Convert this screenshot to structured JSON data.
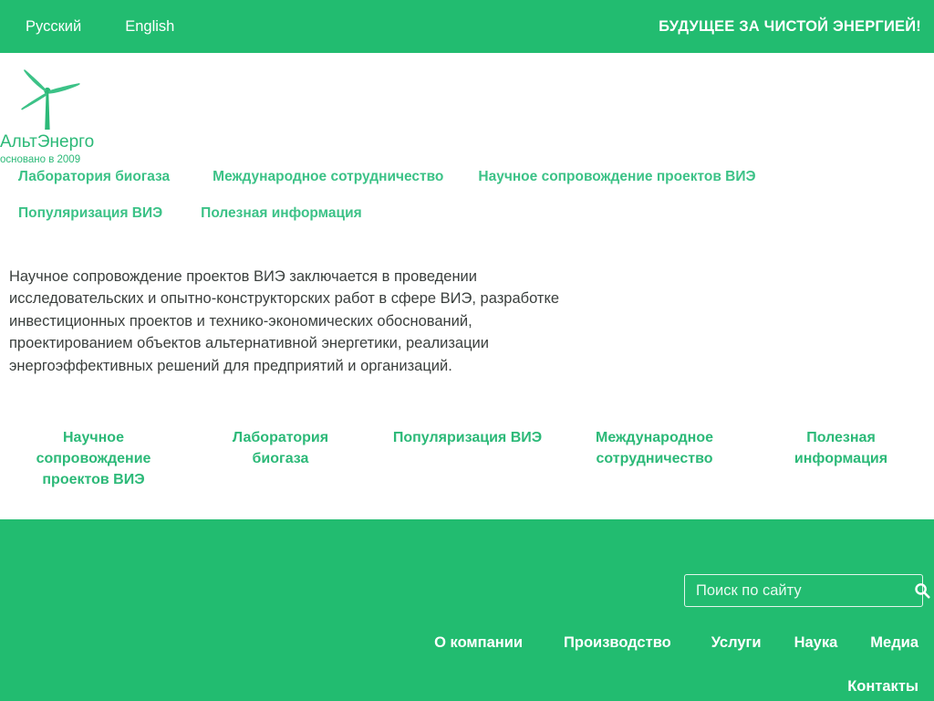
{
  "topbar": {
    "languages": [
      {
        "label": "Русский",
        "name": "lang-ru"
      },
      {
        "label": "English",
        "name": "lang-en"
      }
    ],
    "slogan": "БУДУЩЕЕ ЗА ЧИСТОЙ ЭНЕРГИЕЙ!",
    "background_color": "#22bc70",
    "text_color": "#ffffff"
  },
  "logo": {
    "icon": "wind-turbine-icon",
    "name": "АльтЭнерго",
    "tagline": "основано в 2009",
    "color": "#2cb978"
  },
  "main_nav": {
    "color": "#3cc287",
    "items": [
      {
        "label": "Лаборатория биогаза"
      },
      {
        "label": "Международное сотрудничество"
      },
      {
        "label": "Научное сопровождение проектов ВИЭ"
      },
      {
        "label": "Популяризация ВИЭ"
      },
      {
        "label": "Полезная информация"
      }
    ]
  },
  "article": {
    "text": "Научное сопровождение проектов ВИЭ  заключается в проведении исследовательских и опытно-конструкторских работ в сфере ВИЭ, разработке инвестиционных проектов и технико-экономических обоснований,  проектированием объектов альтернативной энергетики, реализации энергоэффективных решений для предприятий и организаций."
  },
  "cards": {
    "color": "#2cb978",
    "items": [
      {
        "label": "Научное сопровождение проектов ВИЭ"
      },
      {
        "label": "Лаборатория биогаза"
      },
      {
        "label": "Популяризация ВИЭ"
      },
      {
        "label": "Международное сотрудничество"
      },
      {
        "label": "Полезная информация"
      }
    ]
  },
  "footer": {
    "background_color": "#22bc70",
    "search": {
      "placeholder": "Поиск по сайту",
      "value": "",
      "icon": "search-icon"
    },
    "nav": [
      {
        "label": "О компании"
      },
      {
        "label": "Производство"
      },
      {
        "label": "Услуги"
      },
      {
        "label": "Наука"
      },
      {
        "label": "Медиа"
      },
      {
        "label": "Контакты"
      }
    ]
  }
}
